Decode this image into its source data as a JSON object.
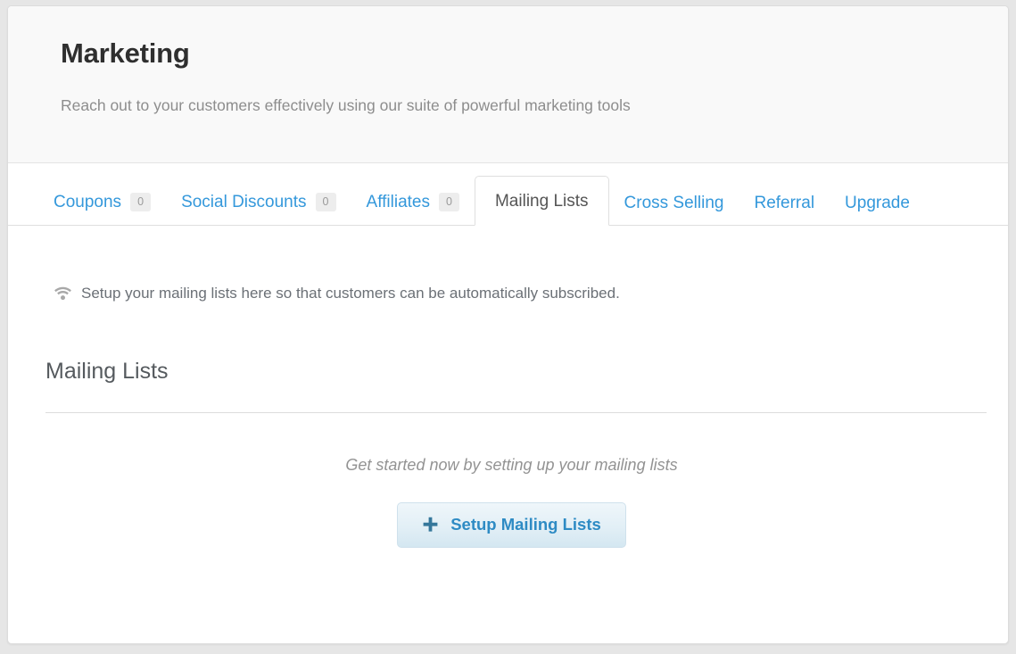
{
  "header": {
    "title": "Marketing",
    "subtitle": "Reach out to your customers effectively using our suite of powerful marketing tools"
  },
  "tabs": [
    {
      "label": "Coupons",
      "badge": "0",
      "active": false
    },
    {
      "label": "Social Discounts",
      "badge": "0",
      "active": false
    },
    {
      "label": "Affiliates",
      "badge": "0",
      "active": false
    },
    {
      "label": "Mailing Lists",
      "badge": null,
      "active": true
    },
    {
      "label": "Cross Selling",
      "badge": null,
      "active": false
    },
    {
      "label": "Referral",
      "badge": null,
      "active": false
    },
    {
      "label": "Upgrade",
      "badge": null,
      "active": false
    }
  ],
  "notice": {
    "icon": "wifi-icon",
    "text": "Setup your mailing lists here so that customers can be automatically subscribed."
  },
  "section": {
    "title": "Mailing Lists"
  },
  "empty_state": {
    "message": "Get started now by setting up your mailing lists",
    "button_label": "Setup Mailing Lists",
    "button_icon": "plus-icon"
  },
  "colors": {
    "link": "#3498db",
    "button_text": "#2e8bc4",
    "button_icon": "#35779b",
    "muted_text": "#939393",
    "heading": "#2f2f2f",
    "page_background": "#e6e6e6"
  }
}
